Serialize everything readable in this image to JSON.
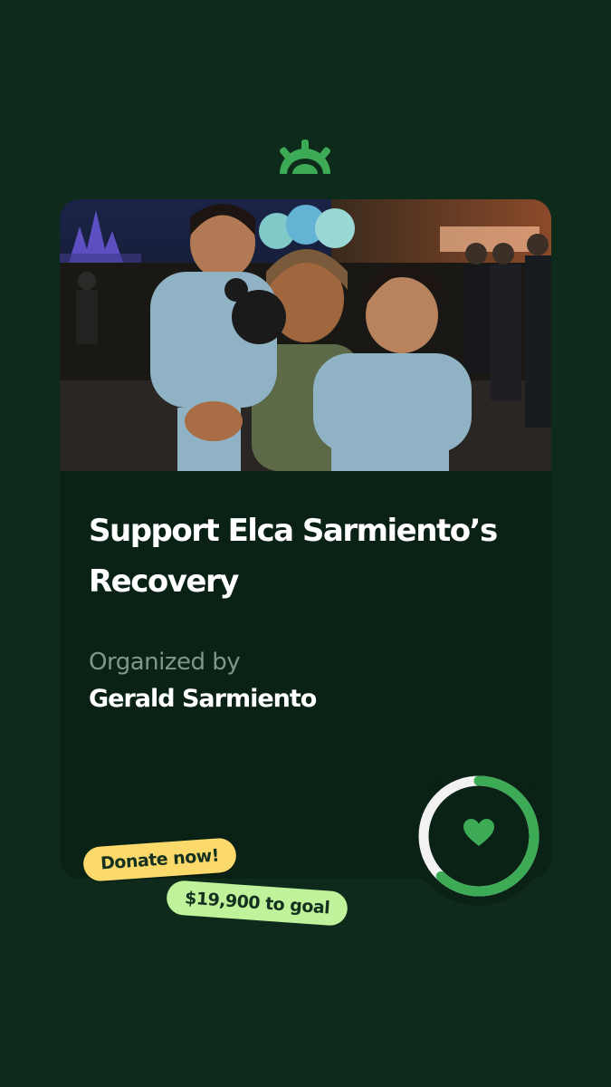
{
  "campaign": {
    "title": "Support Elca Sarmiento’s Recovery",
    "organized_label": "Organized by",
    "organizer_name": "Gerald Sarmiento",
    "donate_label": "Donate now!",
    "goal_label": "$19,900 to goal",
    "progress_fraction": 0.62,
    "photo_alt": "Woman holding two toddlers in matching blue hoodies at a theme park at night"
  },
  "icons": {
    "brand": "gofundme-logo-icon",
    "heart": "heart-icon"
  },
  "colors": {
    "background": "#0d2a1b",
    "card": "#0a2216",
    "accent_green": "#3dab55",
    "ring_track": "#f2f2f2",
    "donate_pill": "#fcd96b",
    "goal_pill": "#bff29a"
  }
}
